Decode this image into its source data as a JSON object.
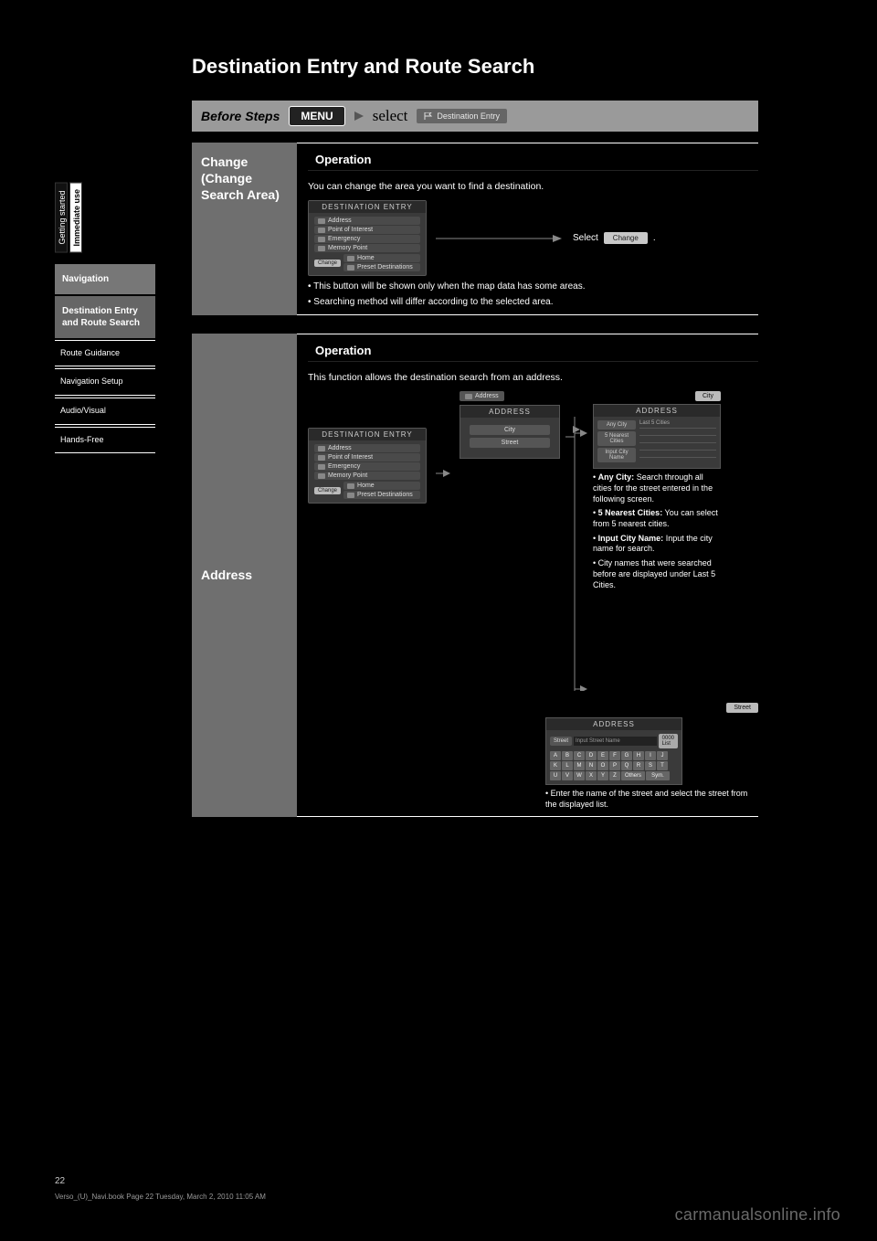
{
  "page": {
    "title": "Destination Entry and Route Search",
    "page_number": "22",
    "footer_fine": "Verso_(U)_Navi.book  Page 22  Tuesday, March 2, 2010  11:05 AM",
    "watermark": "carmanualsonline.info"
  },
  "sidebar": {
    "tabs": {
      "a": "Getting started",
      "b": "Immediate use"
    },
    "current_box": "Navigation",
    "items": {
      "dest": "Destination Entry and Route Search",
      "guide": "Route Guidance",
      "setup": "Navigation Setup",
      "audio": "Audio/Visual",
      "handsfree": "Hands-Free"
    }
  },
  "before_steps": {
    "label": "Before Steps",
    "menu": "MENU",
    "select": "select",
    "dest_entry_chip": "Destination Entry"
  },
  "change": {
    "label": "Change\n(Change\nSearch Area)",
    "op_heading": "Operation",
    "desc": "You can change the area you want to find a destination.",
    "step": "Select",
    "chip": "Change",
    "note1": "• This button will be shown only when the map data has some areas.",
    "note2": "• Searching method will differ according to the selected area.",
    "de_title": "DESTINATION ENTRY",
    "de_items": [
      "Address",
      "Point of Interest",
      "Emergency",
      "Memory Point",
      "Home",
      "Preset Destinations"
    ],
    "de_change": "Change"
  },
  "address": {
    "label": "Address",
    "op_heading": "Operation",
    "desc": "This function allows the destination search from an address.",
    "de_title": "DESTINATION ENTRY",
    "de_items": [
      "Address",
      "Point of Interest",
      "Emergency",
      "Memory Point",
      "Home",
      "Preset Destinations"
    ],
    "de_change": "Change",
    "addr_chip": "Address",
    "mid_title": "ADDRESS",
    "mid_city": "City",
    "mid_street": "Street",
    "city_chip": "City",
    "city_title": "ADDRESS",
    "city_last5_hdr": "Last 5 Cities",
    "city_buttons": [
      "Any City",
      "5 Nearest Cities",
      "Input City Name"
    ],
    "city_notes": {
      "n1_label": "Any City:",
      "n1_body": "Search through all cities for the street entered in the following screen.",
      "n2_label": "5 Nearest Cities:",
      "n2_body": "You can select from 5 nearest cities.",
      "n3_label": "Input City Name:",
      "n3_body": "Input the city name for search.",
      "n4_body": "City names that were searched before are displayed under Last 5 Cities."
    },
    "street_chip": "Street",
    "kb_title": "ADDRESS",
    "kb_label": "Street",
    "kb_input": "Input Street Name",
    "kb_list": "0000\nList",
    "kb_keys_row1": [
      "A",
      "B",
      "C",
      "D",
      "E",
      "F",
      "G",
      "H"
    ],
    "kb_keys_row2": [
      "I",
      "J",
      "K",
      "L",
      "M",
      "N",
      "O",
      "P"
    ],
    "kb_keys_row3": [
      "Q",
      "R",
      "S",
      "T",
      "U",
      "V",
      "W",
      "X"
    ],
    "kb_keys_row4": [
      "Y",
      "Z"
    ],
    "kb_others": "Others",
    "kb_sym": "Sym.",
    "street_note": "Enter the name of the street and select the street from the displayed list."
  }
}
